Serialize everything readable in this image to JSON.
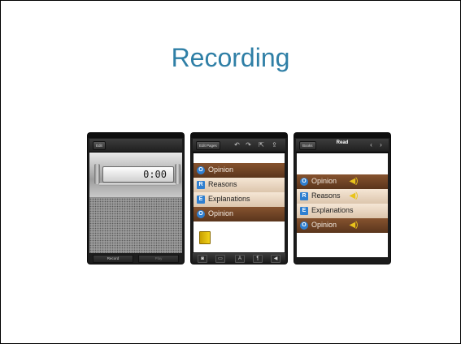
{
  "slide": {
    "title": "Recording"
  },
  "recorder": {
    "nav_button": "Edit",
    "time": "0:00",
    "bottom_buttons": [
      "Record",
      "Play"
    ]
  },
  "editor": {
    "nav_button": "Edit Pages",
    "toolbar_icons": [
      "undo-icon",
      "redo-icon",
      "share-icon",
      "export-icon"
    ],
    "bottom_tools": [
      "camera-icon",
      "folder-icon",
      "text-icon",
      "format-icon",
      "sound-icon"
    ],
    "strips": [
      {
        "label": "Opinion",
        "badge": "O",
        "style": "brown"
      },
      {
        "label": "Reasons",
        "badge": "R",
        "style": "tan"
      },
      {
        "label": "Explanations",
        "badge": "E",
        "style": "tan"
      },
      {
        "label": "Opinion",
        "badge": "O",
        "style": "brown"
      }
    ]
  },
  "reader": {
    "nav_button": "Books",
    "title": "Read",
    "strips": [
      {
        "label": "Opinion",
        "badge": "O",
        "style": "brown"
      },
      {
        "label": "Reasons",
        "badge": "R",
        "style": "tan"
      },
      {
        "label": "Explanations",
        "badge": "E",
        "style": "tan"
      },
      {
        "label": "Opinion",
        "badge": "O",
        "style": "brown"
      }
    ]
  },
  "colors": {
    "title": "#2f7fa6",
    "strip_brown": "#6e4325",
    "strip_tan": "#ead7c1",
    "badge_blue": "#2f7fd0",
    "speaker_yellow": "#e8c31a"
  }
}
